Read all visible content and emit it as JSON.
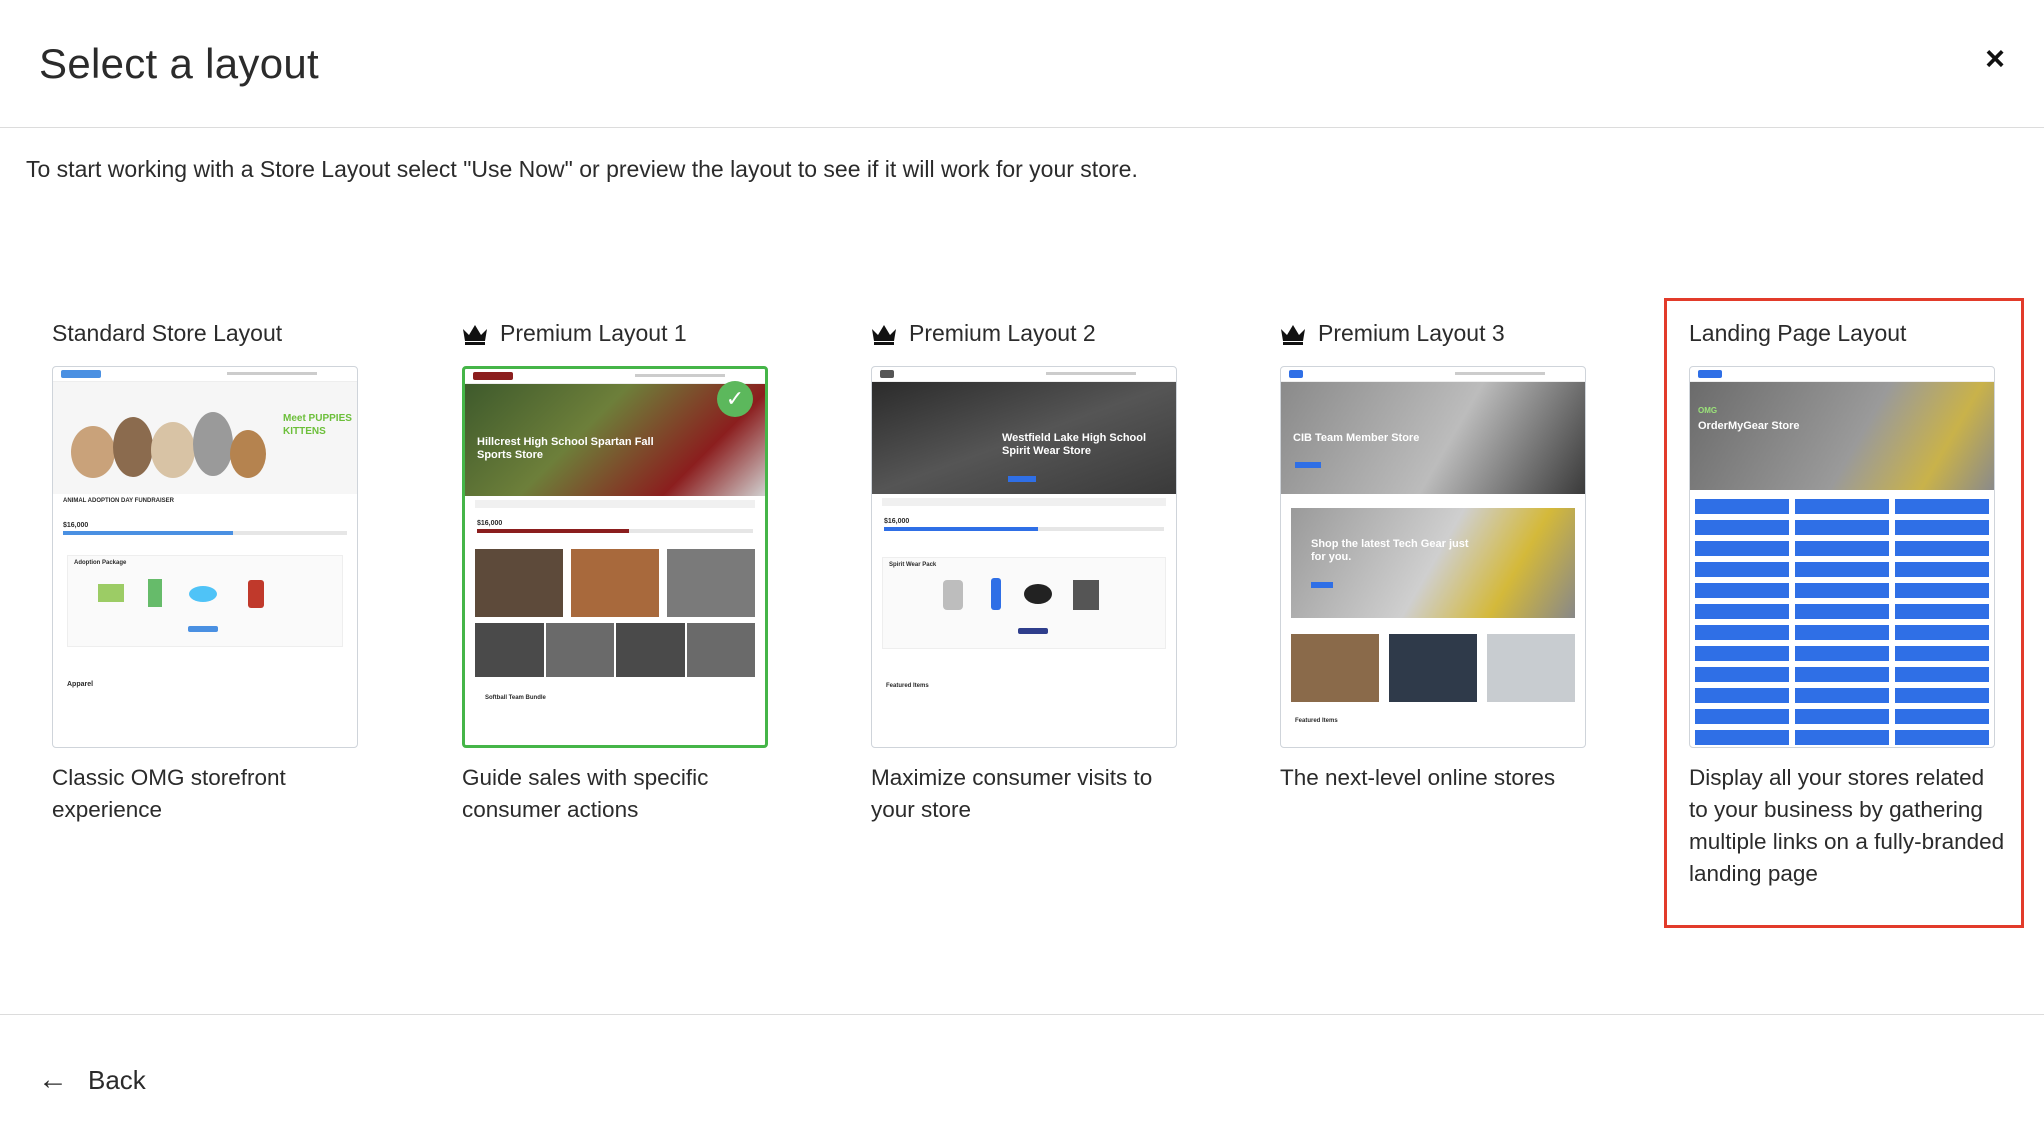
{
  "dialog": {
    "title": "Select a layout",
    "close_label": "×",
    "instructions": "To start working with a Store Layout select \"Use Now\" or preview the layout to see if it will work for your store."
  },
  "layouts": [
    {
      "name": "Standard Store Layout",
      "premium": false,
      "description": "Classic OMG storefront experience",
      "preview": {
        "hero_text": "Meet PUPPIES KITTENS",
        "banner": "ANIMAL ADOPTION DAY FUNDRAISER",
        "goal": "$16,000",
        "package": "Adoption Package",
        "section": "Apparel"
      }
    },
    {
      "name": "Premium Layout 1",
      "premium": true,
      "selected": true,
      "description": "Guide sales with specific consumer actions",
      "preview": {
        "hero_text": "Hillcrest High School Spartan Fall Sports Store",
        "goal": "$16,000",
        "bundle": "Softball Team Bundle"
      }
    },
    {
      "name": "Premium Layout 2",
      "premium": true,
      "description": "Maximize consumer visits to your store",
      "preview": {
        "hero_text": "Westfield Lake High School Spirit Wear Store",
        "goal": "$16,000",
        "pack": "Spirit Wear Pack",
        "section": "Featured Items"
      }
    },
    {
      "name": "Premium Layout 3",
      "premium": true,
      "description": "The next-level online stores",
      "preview": {
        "hero_text": "CIB Team Member Store",
        "promo_text": "Shop the latest Tech Gear just for you.",
        "section": "Featured Items"
      }
    },
    {
      "name": "Landing Page Layout",
      "premium": false,
      "highlighted": true,
      "description": "Display all your stores related to your business by gathering multiple links on a fully-branded landing page",
      "preview": {
        "badge": "OMG",
        "hero_text": "OrderMyGear Store"
      }
    }
  ],
  "footer": {
    "back_label": "Back"
  },
  "colors": {
    "selected_border": "#45b548",
    "highlight_border": "#e23b2a",
    "link_blue": "#2f6fe6"
  }
}
